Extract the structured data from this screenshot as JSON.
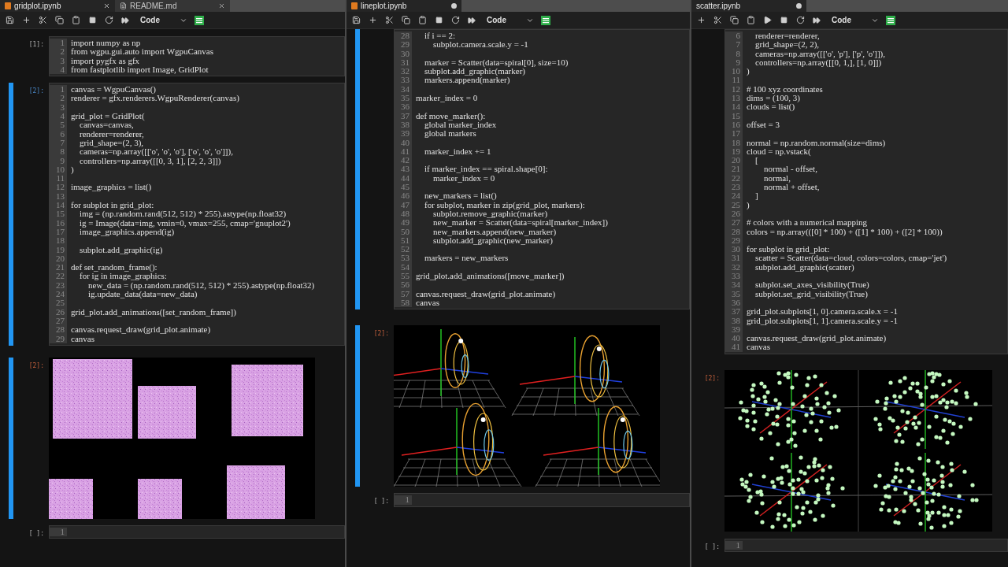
{
  "panes": [
    {
      "tabs": [
        {
          "label": "gridplot.ipynb",
          "kind": "notebook",
          "selected": true,
          "modified": false
        },
        {
          "label": "README.md",
          "kind": "markdown",
          "selected": false,
          "modified": false
        }
      ],
      "toolbar": [
        {
          "kind": "save"
        },
        {
          "kind": "add"
        },
        {
          "kind": "cut"
        },
        {
          "kind": "copy"
        },
        {
          "kind": "paste"
        },
        {
          "kind": "stop"
        },
        {
          "kind": "restart"
        },
        {
          "kind": "run-all"
        }
      ],
      "cell_type": "Code",
      "cells": [
        {
          "kind": "code",
          "prompt": "[1]:",
          "selected": false,
          "lines": [
            {
              "n": "1",
              "code": "import numpy as np"
            },
            {
              "n": "2",
              "code": "from wgpu.gui.auto import WgpuCanvas"
            },
            {
              "n": "3",
              "code": "import pygfx as gfx"
            },
            {
              "n": "4",
              "code": "from fastplotlib import Image, GridPlot"
            }
          ]
        },
        {
          "kind": "code",
          "prompt": "[2]:",
          "selected": true,
          "lines": [
            {
              "n": "1",
              "code": "canvas = WgpuCanvas()"
            },
            {
              "n": "2",
              "code": "renderer = gfx.renderers.WgpuRenderer(canvas)"
            },
            {
              "n": "3"
            },
            {
              "n": "4",
              "code": "grid_plot = GridPlot("
            },
            {
              "n": "5",
              "code": "    canvas=canvas,"
            },
            {
              "n": "6",
              "code": "    renderer=renderer,"
            },
            {
              "n": "7",
              "code": "    grid_shape=(2, 3),"
            },
            {
              "n": "8",
              "code": "    cameras=np.array([['o', 'o', 'o'], ['o', 'o', 'o']]),"
            },
            {
              "n": "9",
              "code": "    controllers=np.array([[0, 3, 1], [2, 2, 3]])"
            },
            {
              "n": "10",
              "code": ")"
            },
            {
              "n": "11"
            },
            {
              "n": "12",
              "code": "image_graphics = list()"
            },
            {
              "n": "13"
            },
            {
              "n": "14",
              "code": "for subplot in grid_plot:"
            },
            {
              "n": "15",
              "code": "    img = (np.random.rand(512, 512) * 255).astype(np.float32)"
            },
            {
              "n": "16",
              "code": "    ig = Image(data=img, vmin=0, vmax=255, cmap='gnuplot2')"
            },
            {
              "n": "17",
              "code": "    image_graphics.append(ig)"
            },
            {
              "n": "18"
            },
            {
              "n": "19",
              "code": "    subplot.add_graphic(ig)"
            },
            {
              "n": "20"
            },
            {
              "n": "21",
              "code": "def set_random_frame():"
            },
            {
              "n": "22",
              "code": "    for ig in image_graphics:"
            },
            {
              "n": "23",
              "code": "        new_data = (np.random.rand(512, 512) * 255).astype(np.float32)"
            },
            {
              "n": "24",
              "code": "        ig.update_data(data=new_data)"
            },
            {
              "n": "25"
            },
            {
              "n": "26",
              "code": "grid_plot.add_animations([set_random_frame])"
            },
            {
              "n": "27"
            },
            {
              "n": "28",
              "code": "canvas.request_draw(grid_plot.animate)"
            },
            {
              "n": "29",
              "code": "canvas"
            }
          ]
        },
        {
          "kind": "images",
          "prompt": "[2]:",
          "selected": true
        },
        {
          "kind": "code",
          "prompt": "[ ]:",
          "selected": false,
          "lines": [
            {
              "n": "1"
            }
          ]
        }
      ]
    },
    {
      "tabs": [
        {
          "label": "lineplot.ipynb",
          "kind": "notebook",
          "selected": true,
          "modified": true
        }
      ],
      "toolbar": [
        {
          "kind": "save"
        },
        {
          "kind": "add"
        },
        {
          "kind": "cut"
        },
        {
          "kind": "copy"
        },
        {
          "kind": "paste"
        },
        {
          "kind": "stop"
        },
        {
          "kind": "restart"
        },
        {
          "kind": "run-all"
        }
      ],
      "cell_type": "Code",
      "cells": [
        {
          "kind": "code",
          "selected": true,
          "lines": [
            {
              "n": "28",
              "code": "    if i == 2:"
            },
            {
              "n": "29",
              "code": "        subplot.camera.scale.y = -1"
            },
            {
              "n": "30"
            },
            {
              "n": "31",
              "code": "    marker = Scatter(data=spiral[0], size=10)"
            },
            {
              "n": "32",
              "code": "    subplot.add_graphic(marker)"
            },
            {
              "n": "33",
              "code": "    markers.append(marker)"
            },
            {
              "n": "34"
            },
            {
              "n": "35",
              "code": "marker_index = 0"
            },
            {
              "n": "36"
            },
            {
              "n": "37",
              "code": "def move_marker():"
            },
            {
              "n": "38",
              "code": "    global marker_index"
            },
            {
              "n": "39",
              "code": "    global markers"
            },
            {
              "n": "40"
            },
            {
              "n": "41",
              "code": "    marker_index += 1"
            },
            {
              "n": "42"
            },
            {
              "n": "43",
              "code": "    if marker_index == spiral.shape[0]:"
            },
            {
              "n": "44",
              "code": "        marker_index = 0"
            },
            {
              "n": "45"
            },
            {
              "n": "46",
              "code": "    new_markers = list()"
            },
            {
              "n": "47",
              "code": "    for subplot, marker in zip(grid_plot, markers):"
            },
            {
              "n": "48",
              "code": "        subplot.remove_graphic(marker)"
            },
            {
              "n": "49",
              "code": "        new_marker = Scatter(data=spiral[marker_index])"
            },
            {
              "n": "50",
              "code": "        new_markers.append(new_marker)"
            },
            {
              "n": "51",
              "code": "        subplot.add_graphic(new_marker)"
            },
            {
              "n": "52"
            },
            {
              "n": "53",
              "code": "    markers = new_markers"
            },
            {
              "n": "54"
            },
            {
              "n": "55",
              "code": "grid_plot.add_animations([move_marker])"
            },
            {
              "n": "56"
            },
            {
              "n": "57",
              "code": "canvas.request_draw(grid_plot.animate)"
            },
            {
              "n": "58",
              "code": "canvas"
            }
          ]
        },
        {
          "kind": "lines3d",
          "prompt": "[2]:",
          "selected": true
        },
        {
          "kind": "code",
          "prompt": "[ ]:",
          "selected": false,
          "lines": [
            {
              "n": "1"
            }
          ]
        }
      ]
    },
    {
      "tabs": [
        {
          "label": "scatter.ipynb",
          "selected": true,
          "modified": true
        }
      ],
      "toolbar": [
        {
          "kind": "add"
        },
        {
          "kind": "cut"
        },
        {
          "kind": "copy"
        },
        {
          "kind": "paste"
        },
        {
          "kind": "run"
        },
        {
          "kind": "stop"
        },
        {
          "kind": "restart"
        },
        {
          "kind": "run-all"
        }
      ],
      "cell_type": "Code",
      "cells": [
        {
          "kind": "code",
          "selected": false,
          "lines": [
            {
              "n": "6",
              "code": "    renderer=renderer,"
            },
            {
              "n": "7",
              "code": "    grid_shape=(2, 2),"
            },
            {
              "n": "8",
              "code": "    cameras=np.array([['o', 'p'], ['p', 'o']]),"
            },
            {
              "n": "9",
              "code": "    controllers=np.array([[0, 1,], [1, 0]])"
            },
            {
              "n": "10",
              "code": ")"
            },
            {
              "n": "11"
            },
            {
              "n": "12",
              "code": "# 100 xyz coordinates"
            },
            {
              "n": "13",
              "code": "dims = (100, 3)"
            },
            {
              "n": "14",
              "code": "clouds = list()"
            },
            {
              "n": "15"
            },
            {
              "n": "16",
              "code": "offset = 3"
            },
            {
              "n": "17"
            },
            {
              "n": "18",
              "code": "normal = np.random.normal(size=dims)"
            },
            {
              "n": "19",
              "code": "cloud = np.vstack("
            },
            {
              "n": "20",
              "code": "    ["
            },
            {
              "n": "21",
              "code": "        normal - offset,"
            },
            {
              "n": "22",
              "code": "        normal,"
            },
            {
              "n": "23",
              "code": "        normal + offset,"
            },
            {
              "n": "24",
              "code": "    ]"
            },
            {
              "n": "25",
              "code": ")"
            },
            {
              "n": "26"
            },
            {
              "n": "27",
              "code": "# colors with a numerical mapping"
            },
            {
              "n": "28",
              "code": "colors = np.array(([0] * 100) + ([1] * 100) + ([2] * 100))"
            },
            {
              "n": "29"
            },
            {
              "n": "30",
              "code": "for subplot in grid_plot:"
            },
            {
              "n": "31",
              "code": "    scatter = Scatter(data=cloud, colors=colors, cmap='jet')"
            },
            {
              "n": "32",
              "code": "    subplot.add_graphic(scatter)"
            },
            {
              "n": "33"
            },
            {
              "n": "34",
              "code": "    subplot.set_axes_visibility(True)"
            },
            {
              "n": "35",
              "code": "    subplot.set_grid_visibility(True)"
            },
            {
              "n": "36"
            },
            {
              "n": "37",
              "code": "grid_plot.subplots[1, 0].camera.scale.x = -1"
            },
            {
              "n": "38",
              "code": "grid_plot.subplots[1, 1].camera.scale.y = -1"
            },
            {
              "n": "39"
            },
            {
              "n": "40",
              "code": "canvas.request_draw(grid_plot.animate)"
            },
            {
              "n": "41",
              "code": "canvas"
            }
          ]
        },
        {
          "kind": "scatter",
          "prompt": "[2]:",
          "selected": false
        },
        {
          "kind": "code",
          "prompt": "[ ]:",
          "selected": false,
          "lines": [
            {
              "n": "1"
            }
          ]
        }
      ]
    }
  ]
}
